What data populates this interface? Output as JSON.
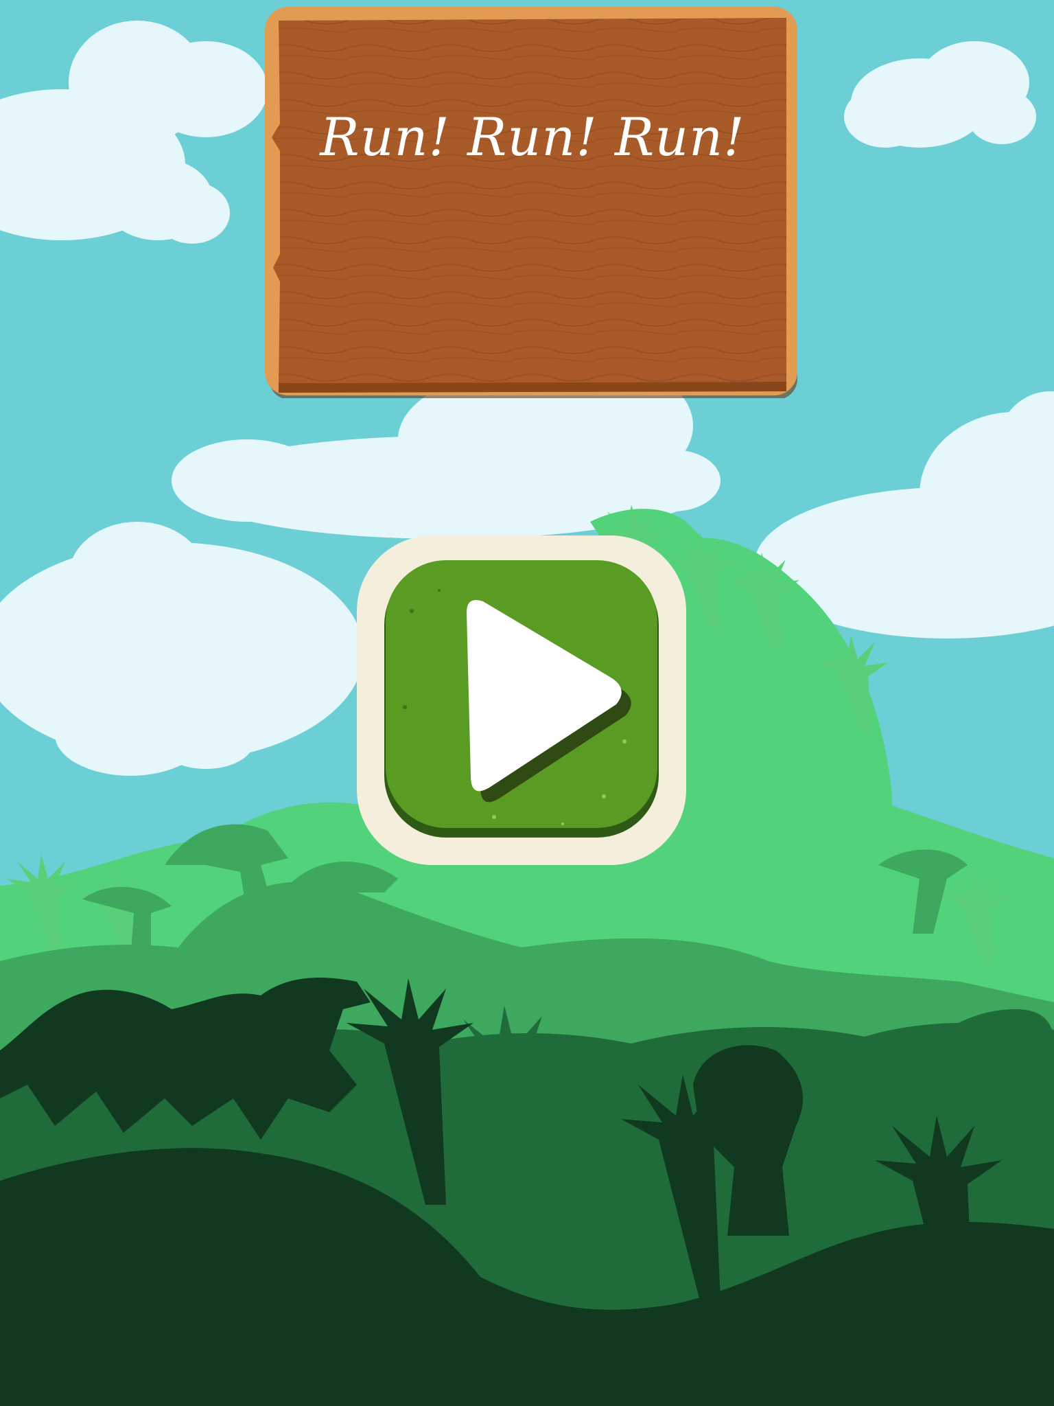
{
  "game": {
    "title": "Run! Run! Run!",
    "play_icon": "play-triangle-icon"
  },
  "colors": {
    "sky": "#6ccfd6",
    "cloud": "#e6f7fb",
    "sign_wood": "#a85a28",
    "sign_border": "#e29b52",
    "button_green": "#5a9b23",
    "button_frame": "#f4efdc",
    "forest_far": "#52d27a",
    "forest_mid": "#3ea85e",
    "forest_near": "#1f6b3a",
    "forest_front": "#11391f"
  }
}
